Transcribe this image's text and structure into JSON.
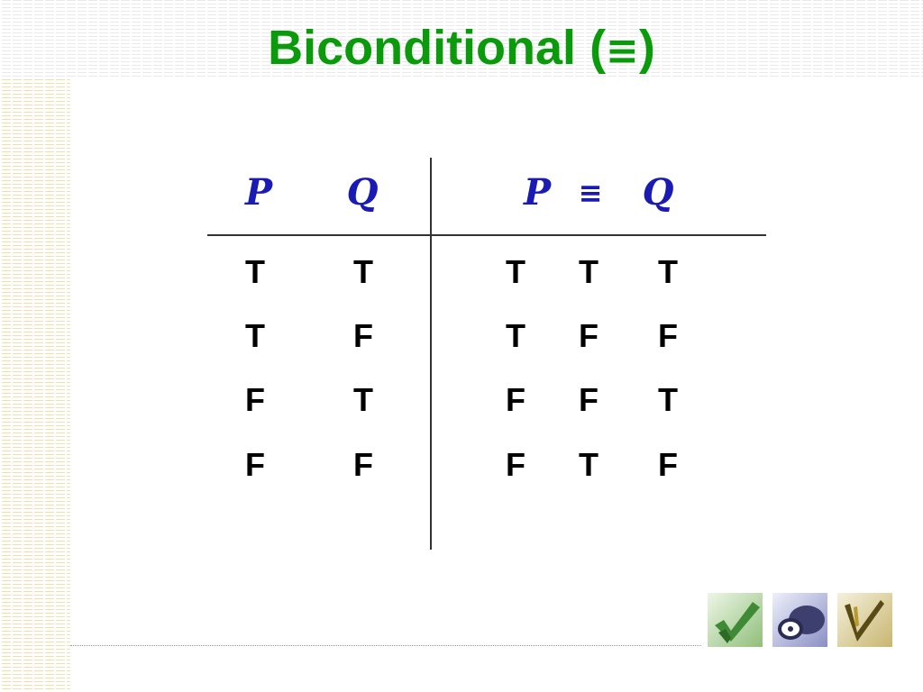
{
  "slide": {
    "title_text": "Biconditional (",
    "title_symbol": "≡",
    "title_close": ")"
  },
  "table": {
    "headers_left": [
      "P",
      "Q"
    ],
    "headers_right": [
      "P",
      "≡",
      "Q"
    ],
    "rows": [
      {
        "p": "T",
        "q": "T",
        "r1": "T",
        "r2": "T",
        "r3": "T"
      },
      {
        "p": "T",
        "q": "F",
        "r1": "T",
        "r2": "F",
        "r3": "F"
      },
      {
        "p": "F",
        "q": "T",
        "r1": "F",
        "r2": "F",
        "r3": "T"
      },
      {
        "p": "F",
        "q": "F",
        "r1": "F",
        "r2": "T",
        "r3": "F"
      }
    ]
  },
  "icons": [
    "green-checkmark-icon",
    "cd-disc-icon",
    "pen-checkmark-icon"
  ],
  "colors": {
    "title": "#0b9a0b",
    "header_vars": "#1a1ab4",
    "cell_text": "#000000"
  }
}
